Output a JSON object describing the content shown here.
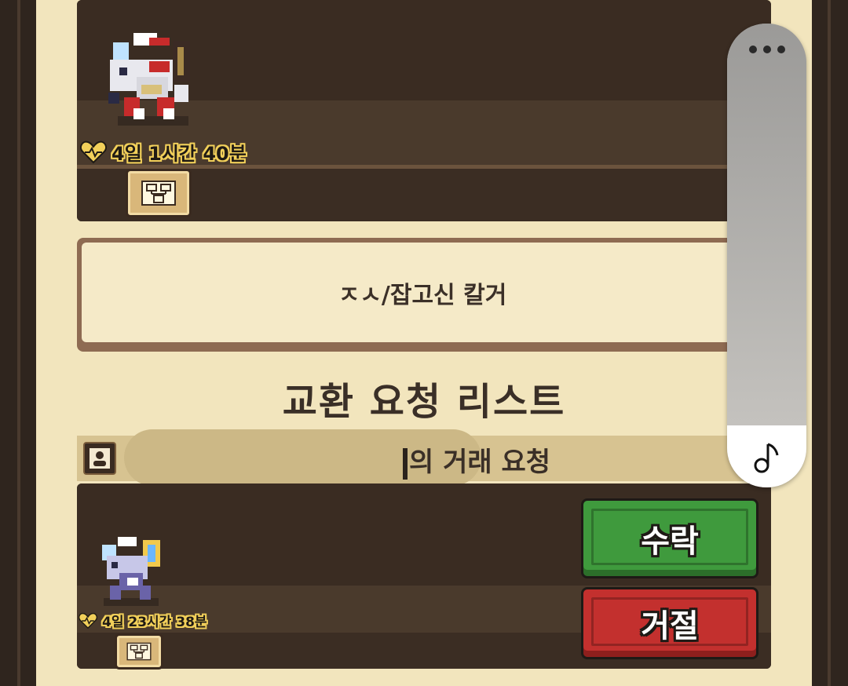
{
  "top_card": {
    "timer": "4일 1시간 40분"
  },
  "recipient_name": "ㅈㅅ/잡고신 칼거",
  "trade_list": {
    "title": "교환 요청 리스트",
    "request_title": "의 거래 요청",
    "timer": "4일 23시간 38분",
    "accept_label": "수락",
    "reject_label": "거절"
  },
  "side_widget": {
    "more_icon": "more-dots-icon",
    "music_icon": "music-note-icon"
  },
  "colors": {
    "accept": "#3f9a3d",
    "reject": "#c3302e",
    "panel": "#f2e5bd",
    "timer_heart": "#f2d05a"
  }
}
